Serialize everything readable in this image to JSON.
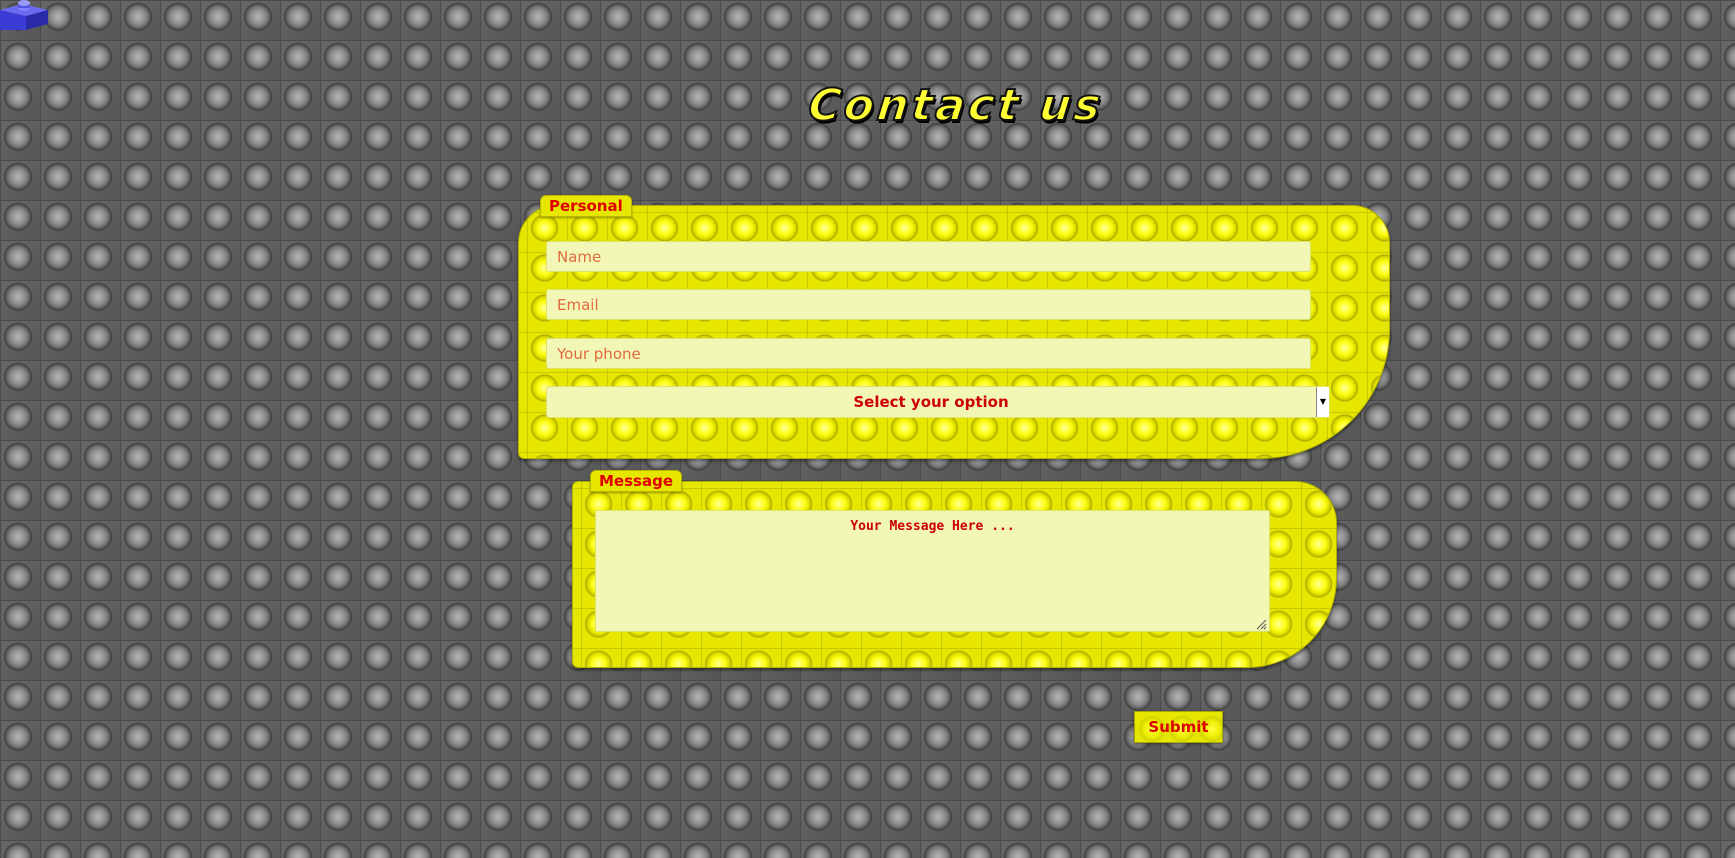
{
  "header": {
    "title": "Contact us"
  },
  "corner_icon": "blue-brick-icon",
  "colors": {
    "accent_yellow": "#e6e600",
    "label_red": "#e00000",
    "field_bg": "#f3f7b5",
    "baseplate_gray": "#5c5c5c",
    "brick_blue": "#3b3bd6"
  },
  "personal": {
    "legend": "Personal",
    "name_placeholder": "Name",
    "email_placeholder": "Email",
    "phone_placeholder": "Your phone",
    "select_value": "Select your option"
  },
  "message": {
    "legend": "Message",
    "placeholder": "Your Message Here  ..."
  },
  "actions": {
    "submit_label": "Submit"
  }
}
